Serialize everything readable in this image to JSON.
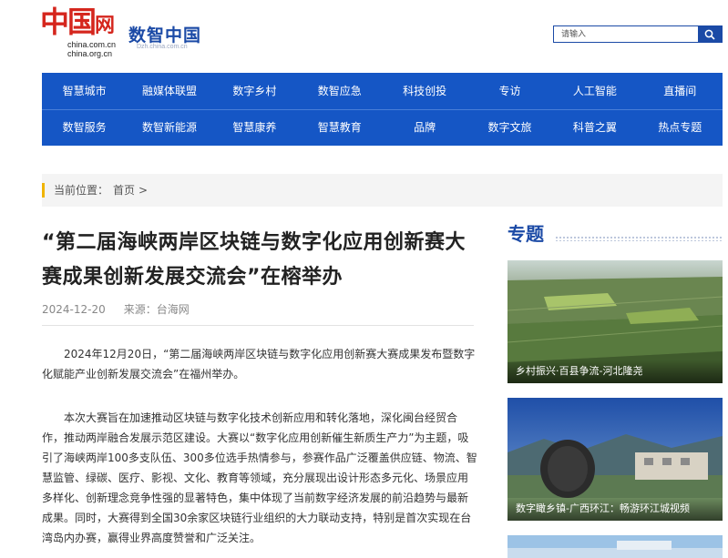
{
  "header": {
    "logo_text": "中国网",
    "logo_url1": "china.com.cn",
    "logo_url2": "china.org.cn",
    "site_name": "数智中国",
    "site_sub": "Dzh.china.com.cn",
    "search_placeholder": "请输入"
  },
  "nav": {
    "row1": [
      "智慧城市",
      "融媒体联盟",
      "数字乡村",
      "数智应急",
      "科技创投",
      "专访",
      "人工智能",
      "直播间"
    ],
    "row2": [
      "数智服务",
      "数智新能源",
      "智慧康养",
      "智慧教育",
      "品牌",
      "数字文旅",
      "科普之翼",
      "热点专题"
    ]
  },
  "breadcrumb": {
    "label": "当前位置：",
    "home": "首页",
    "sep": ">"
  },
  "article": {
    "title": "“第二届海峡两岸区块链与数字化应用创新赛大赛成果创新发展交流会”在榕举办",
    "date": "2024-12-20",
    "source": "来源：台海网",
    "p1": "2024年12月20日，“第二届海峡两岸区块链与数字化应用创新赛大赛成果发布暨数字化赋能产业创新发展交流会”在福州举办。",
    "p2": "本次大赛旨在加速推动区块链与数字化技术创新应用和转化落地，深化闽台经贸合作，推动两岸融合发展示范区建设。大赛以“数字化应用创新催生新质生产力”为主题，吸引了海峡两岸100多支队伍、300多位选手热情参与，参赛作品广泛覆盖供应链、物流、智慧监管、绿碳、医疗、影视、文化、教育等领域，充分展现出设计形态多元化、场景应用多样化、创新理念竞争性强的显著特色，集中体现了当前数字经济发展的前沿趋势与最新成果。同时，大赛得到全国30余家区块链行业组织的大力联动支持，特别是首次实现在台湾岛内办赛，赢得业界高度赞誉和广泛关注。"
  },
  "sidebar": {
    "title": "专题",
    "cards": [
      {
        "caption": "乡村振兴·百县争流-河北隆尧"
      },
      {
        "caption": "数字瞰乡镇-广西环江：畅游环江城视频"
      },
      {
        "caption": ""
      }
    ]
  },
  "colors": {
    "brand_blue": "#1556c5",
    "logo_red": "#d5261d",
    "accent_yellow": "#f0b400"
  }
}
